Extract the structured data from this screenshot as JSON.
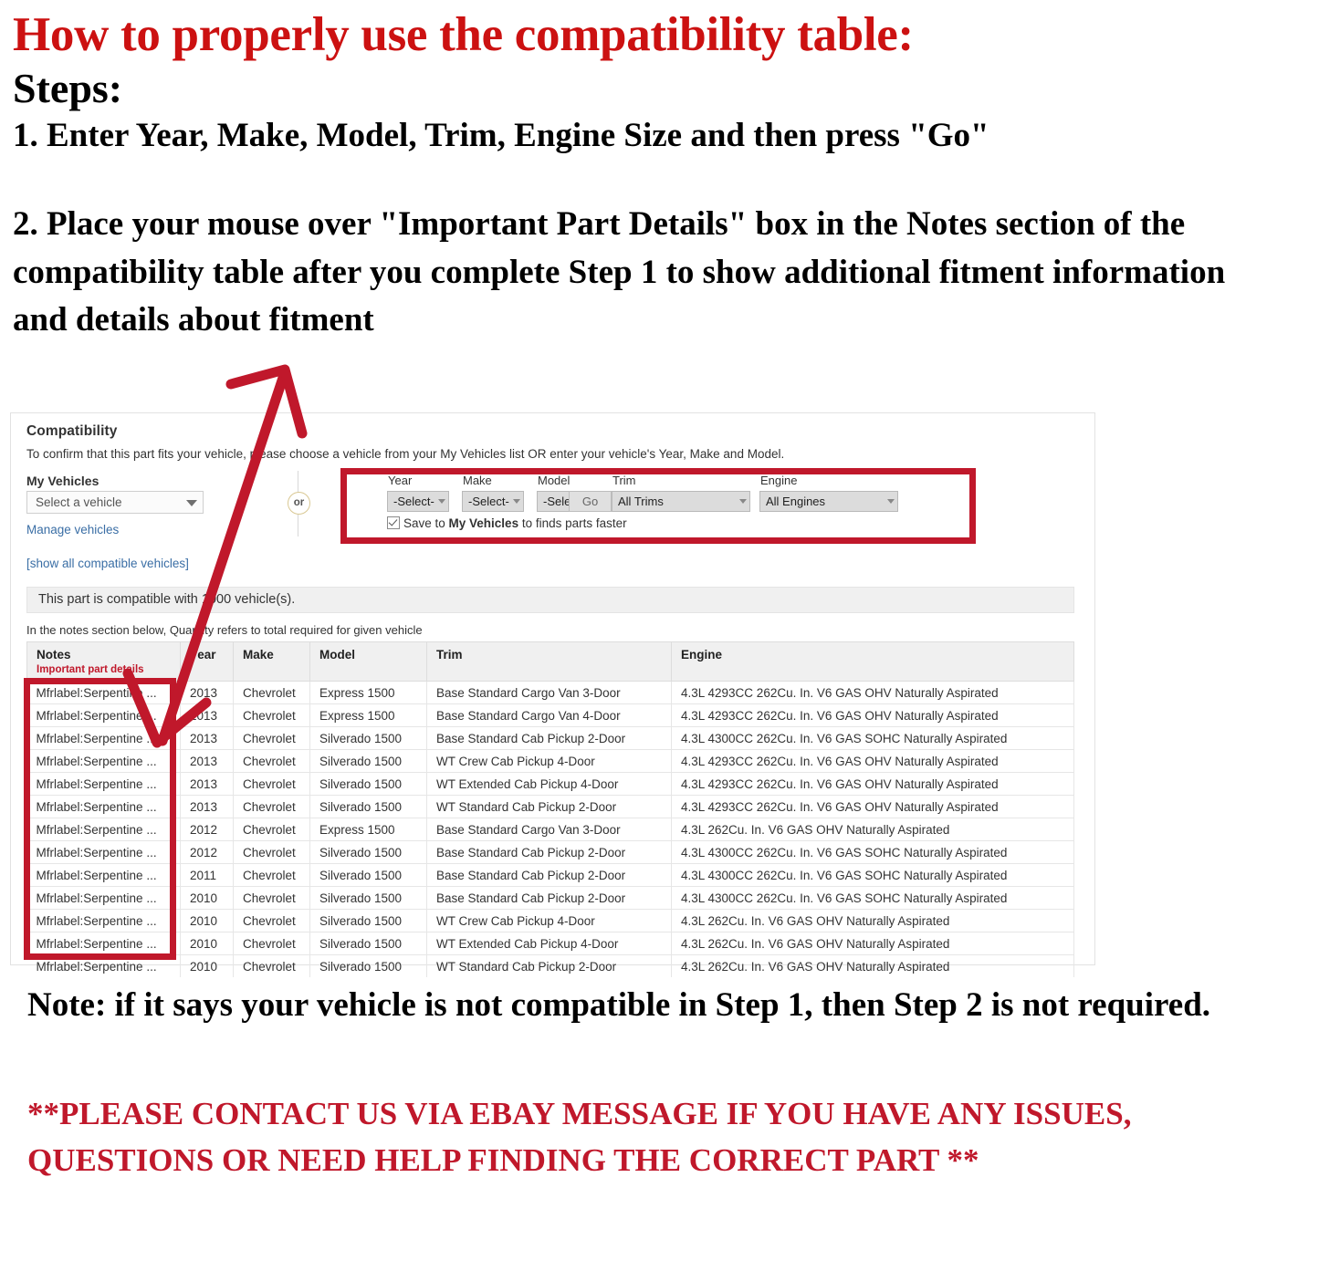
{
  "instructions": {
    "headline": "How to properly use the compatibility table:",
    "steps_label": "Steps:",
    "step1": "1. Enter Year, Make, Model, Trim, Engine Size and then press \"Go\"",
    "step2": "2. Place your mouse over \"Important Part Details\" box in the Notes section of the compatibility table after you complete Step 1 to show additional fitment information and details about fitment"
  },
  "compatibility": {
    "title": "Compatibility",
    "subtitle": "To confirm that this part fits your vehicle, please choose a vehicle from your My Vehicles list OR enter your vehicle's Year, Make and Model.",
    "my_vehicles_label": "My Vehicles",
    "vehicle_select_value": "Select a vehicle",
    "manage_vehicles_link": "Manage vehicles",
    "show_all_link": "[show all compatible vehicles]",
    "or_divider": "or",
    "fields": [
      {
        "label": "Year",
        "value": "-Select-"
      },
      {
        "label": "Make",
        "value": "-Select-"
      },
      {
        "label": "Model",
        "value": "-Select-"
      },
      {
        "label": "Trim",
        "value": "All Trims"
      },
      {
        "label": "Engine",
        "value": "All Engines"
      }
    ],
    "go_label": "Go",
    "save_checkbox": {
      "checked": true,
      "text_before": "Save to ",
      "text_bold": "My Vehicles",
      "text_after": " to finds parts faster"
    },
    "compatible_bar": "This part is compatible with 1000 vehicle(s).",
    "notes_hint": "In the notes section below, Quantity refers to total required for given vehicle",
    "accent_red": "#c0182b"
  },
  "table": {
    "headers": {
      "notes": "Notes",
      "notes_sub": "Important part details",
      "year": "Year",
      "make": "Make",
      "model": "Model",
      "trim": "Trim",
      "engine": "Engine"
    },
    "rows": [
      {
        "notes": "Mfrlabel:Serpentine ...",
        "year": "2013",
        "make": "Chevrolet",
        "model": "Express 1500",
        "trim": "Base Standard Cargo Van 3-Door",
        "engine": "4.3L 4293CC 262Cu. In. V6 GAS OHV Naturally Aspirated"
      },
      {
        "notes": "Mfrlabel:Serpentine ...",
        "year": "2013",
        "make": "Chevrolet",
        "model": "Express 1500",
        "trim": "Base Standard Cargo Van 4-Door",
        "engine": "4.3L 4293CC 262Cu. In. V6 GAS OHV Naturally Aspirated"
      },
      {
        "notes": "Mfrlabel:Serpentine ...",
        "year": "2013",
        "make": "Chevrolet",
        "model": "Silverado 1500",
        "trim": "Base Standard Cab Pickup 2-Door",
        "engine": "4.3L 4300CC 262Cu. In. V6 GAS SOHC Naturally Aspirated"
      },
      {
        "notes": "Mfrlabel:Serpentine ...",
        "year": "2013",
        "make": "Chevrolet",
        "model": "Silverado 1500",
        "trim": "WT Crew Cab Pickup 4-Door",
        "engine": "4.3L 4293CC 262Cu. In. V6 GAS OHV Naturally Aspirated"
      },
      {
        "notes": "Mfrlabel:Serpentine ...",
        "year": "2013",
        "make": "Chevrolet",
        "model": "Silverado 1500",
        "trim": "WT Extended Cab Pickup 4-Door",
        "engine": "4.3L 4293CC 262Cu. In. V6 GAS OHV Naturally Aspirated"
      },
      {
        "notes": "Mfrlabel:Serpentine ...",
        "year": "2013",
        "make": "Chevrolet",
        "model": "Silverado 1500",
        "trim": "WT Standard Cab Pickup 2-Door",
        "engine": "4.3L 4293CC 262Cu. In. V6 GAS OHV Naturally Aspirated"
      },
      {
        "notes": "Mfrlabel:Serpentine ...",
        "year": "2012",
        "make": "Chevrolet",
        "model": "Express 1500",
        "trim": "Base Standard Cargo Van 3-Door",
        "engine": "4.3L 262Cu. In. V6 GAS OHV Naturally Aspirated"
      },
      {
        "notes": "Mfrlabel:Serpentine ...",
        "year": "2012",
        "make": "Chevrolet",
        "model": "Silverado 1500",
        "trim": "Base Standard Cab Pickup 2-Door",
        "engine": "4.3L 4300CC 262Cu. In. V6 GAS SOHC Naturally Aspirated"
      },
      {
        "notes": "Mfrlabel:Serpentine ...",
        "year": "2011",
        "make": "Chevrolet",
        "model": "Silverado 1500",
        "trim": "Base Standard Cab Pickup 2-Door",
        "engine": "4.3L 4300CC 262Cu. In. V6 GAS SOHC Naturally Aspirated"
      },
      {
        "notes": "Mfrlabel:Serpentine ...",
        "year": "2010",
        "make": "Chevrolet",
        "model": "Silverado 1500",
        "trim": "Base Standard Cab Pickup 2-Door",
        "engine": "4.3L 4300CC 262Cu. In. V6 GAS SOHC Naturally Aspirated"
      },
      {
        "notes": "Mfrlabel:Serpentine ...",
        "year": "2010",
        "make": "Chevrolet",
        "model": "Silverado 1500",
        "trim": "WT Crew Cab Pickup 4-Door",
        "engine": "4.3L 262Cu. In. V6 GAS OHV Naturally Aspirated"
      },
      {
        "notes": "Mfrlabel:Serpentine ...",
        "year": "2010",
        "make": "Chevrolet",
        "model": "Silverado 1500",
        "trim": "WT Extended Cab Pickup 4-Door",
        "engine": "4.3L 262Cu. In. V6 GAS OHV Naturally Aspirated"
      },
      {
        "notes": "Mfrlabel:Serpentine ...",
        "year": "2010",
        "make": "Chevrolet",
        "model": "Silverado 1500",
        "trim": "WT Standard Cab Pickup 2-Door",
        "engine": "4.3L 262Cu. In. V6 GAS OHV Naturally Aspirated"
      }
    ]
  },
  "footer": {
    "note": "Note: if it says your vehicle is not compatible in Step 1, then Step 2 is not required.",
    "contact": "**PLEASE CONTACT US VIA EBAY MESSAGE IF YOU HAVE ANY ISSUES, QUESTIONS OR NEED HELP FINDING THE CORRECT PART **"
  }
}
